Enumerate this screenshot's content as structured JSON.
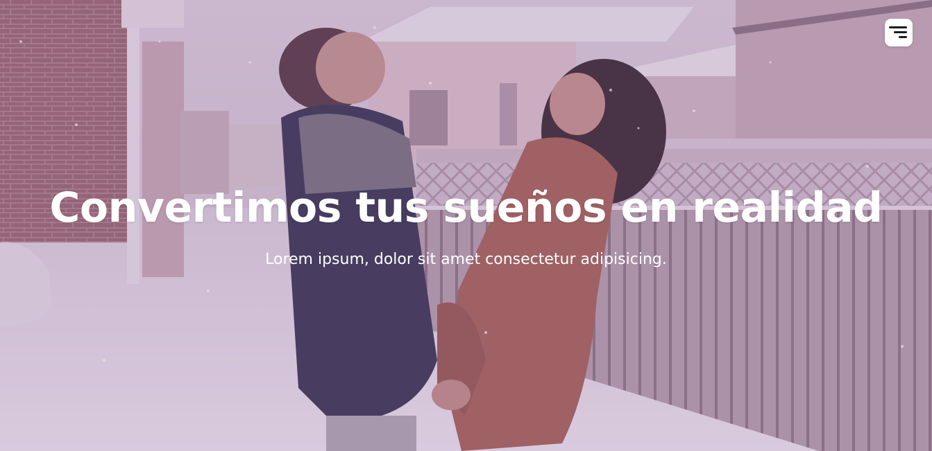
{
  "hero": {
    "title": "Convertimos tus sueños en realidad",
    "subtitle": "Lorem ipsum, dolor sit amet consectetur adipisicing.",
    "background_image": "couple-in-snow-photo"
  },
  "nav": {
    "menu_icon": "hamburger-menu-icon"
  },
  "colors": {
    "text": "#ffffff",
    "overlay": "#7850960",
    "menu_button_bg": "#ffffff",
    "menu_bars": "#1a1a1a"
  }
}
